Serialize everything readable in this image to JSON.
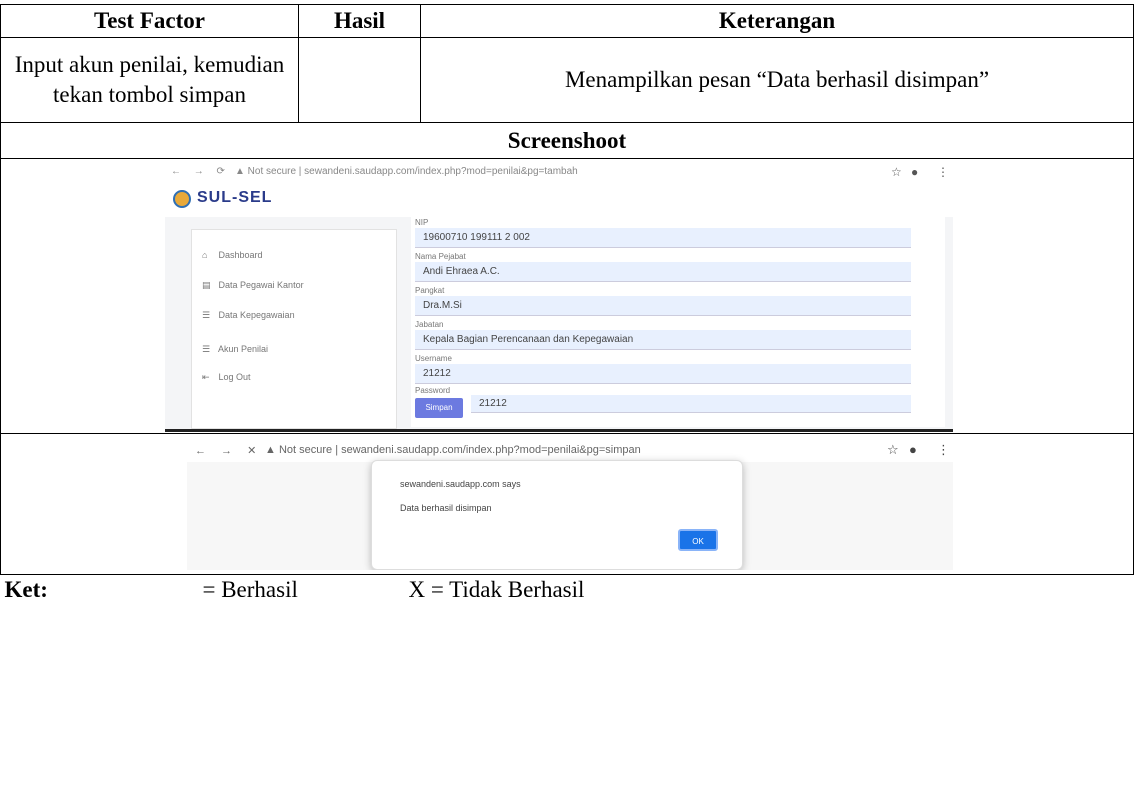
{
  "table": {
    "headers": [
      "Test Factor",
      "Hasil",
      "Keterangan"
    ],
    "row": {
      "test_factor_line1": "Input akun penilai, kemudian",
      "test_factor_line2": "tekan tombol simpan",
      "hasil": "",
      "keterangan": "Menampilkan pesan “Data berhasil disimpan”"
    },
    "screenshot_heading": "Screenshoot"
  },
  "screenshot1": {
    "nav_glyphs": "← → ⟳",
    "url": "▲ Not secure | sewandeni.saudapp.com/index.php?mod=penilai&pg=tambah",
    "app_name": "SUL-SEL",
    "sidebar": [
      {
        "icon": "⌂",
        "label": "Dashboard"
      },
      {
        "icon": "▤",
        "label": "Data Pegawai Kantor"
      },
      {
        "icon": "☰",
        "label": "Data Kepegawaian"
      },
      {
        "icon": "☰",
        "label": "Akun Penilai"
      },
      {
        "icon": "⇤",
        "label": "Log Out"
      }
    ],
    "fields": [
      {
        "label": "NIP",
        "value": "19600710 199111 2 002"
      },
      {
        "label": "Nama Pejabat",
        "value": "Andi Ehraea A.C."
      },
      {
        "label": "Pangkat",
        "value": "Dra.M.Si"
      },
      {
        "label": "Jabatan",
        "value": "Kepala Bagian Perencanaan dan Kepegawaian"
      },
      {
        "label": "Username",
        "value": "21212"
      },
      {
        "label": "Password",
        "value": "21212"
      }
    ],
    "save_label": "Simpan"
  },
  "screenshot2": {
    "nav_glyphs": "← → ✕",
    "url": "▲ Not secure | sewandeni.saudapp.com/index.php?mod=penilai&pg=simpan",
    "dialog_title": "sewandeni.saudapp.com says",
    "dialog_message": "Data berhasil disimpan",
    "ok_label": "OK"
  },
  "ket": {
    "label": "Ket:",
    "berhasil": "= Berhasil",
    "tidak_berhasil": "X = Tidak Berhasil"
  }
}
